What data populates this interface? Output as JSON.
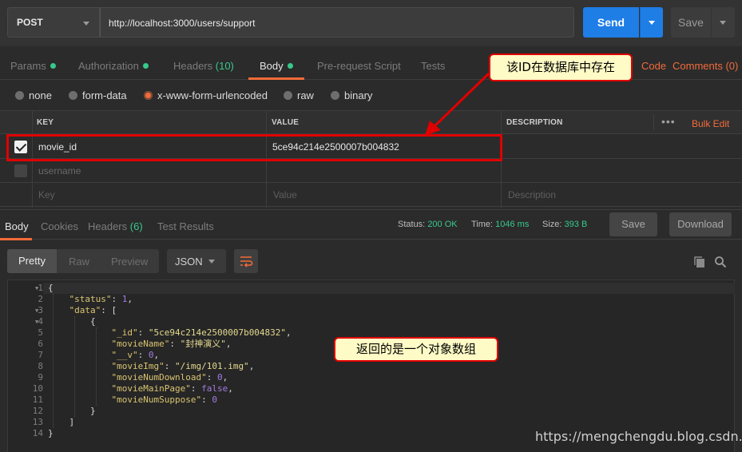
{
  "request": {
    "method": "POST",
    "url": "http://localhost:3000/users/support",
    "send_label": "Send",
    "save_label": "Save"
  },
  "request_tabs": [
    {
      "label": "Params",
      "dot": true,
      "active": false
    },
    {
      "label": "Authorization",
      "dot": true,
      "active": false
    },
    {
      "label": "Headers",
      "count": "(10)",
      "active": false
    },
    {
      "label": "Body",
      "dot": true,
      "active": true
    },
    {
      "label": "Pre-request Script",
      "active": false
    },
    {
      "label": "Tests",
      "active": false
    }
  ],
  "request_tabs_right": {
    "code": "Code",
    "comments": "Comments (0)"
  },
  "body_types": [
    {
      "label": "none",
      "selected": false
    },
    {
      "label": "form-data",
      "selected": false
    },
    {
      "label": "x-www-form-urlencoded",
      "selected": true
    },
    {
      "label": "raw",
      "selected": false
    },
    {
      "label": "binary",
      "selected": false
    }
  ],
  "params_table": {
    "headers": {
      "key": "KEY",
      "value": "VALUE",
      "description": "DESCRIPTION"
    },
    "bulk_edit": "Bulk Edit",
    "rows": [
      {
        "checked": true,
        "key": "movie_id",
        "value": "5ce94c214e2500007b004832",
        "description": ""
      },
      {
        "checked": false,
        "key": "username",
        "value": "",
        "description": ""
      }
    ],
    "placeholders": {
      "key": "Key",
      "value": "Value",
      "description": "Description"
    }
  },
  "response": {
    "tabs": [
      {
        "label": "Body",
        "active": true
      },
      {
        "label": "Cookies",
        "active": false
      },
      {
        "label": "Headers",
        "count": "(6)",
        "active": false
      },
      {
        "label": "Test Results",
        "active": false
      }
    ],
    "status_label": "Status:",
    "status": "200 OK",
    "time_label": "Time:",
    "time": "1046 ms",
    "size_label": "Size:",
    "size": "393 B",
    "save_label": "Save",
    "download_label": "Download"
  },
  "viewer": {
    "modes": [
      "Pretty",
      "Raw",
      "Preview"
    ],
    "active_mode": "Pretty",
    "format": "JSON"
  },
  "code_lines": [
    "{",
    "    \"status\": 1,",
    "    \"data\": [",
    "        {",
    "            \"_id\": \"5ce94c214e2500007b004832\",",
    "            \"movieName\": \"封神演义\",",
    "            \"__v\": 0,",
    "            \"movieImg\": \"/img/101.img\",",
    "            \"movieNumDownload\": 0,",
    "            \"movieMainPage\": false,",
    "            \"movieNumSuppose\": 0",
    "        }",
    "    ]",
    "}"
  ],
  "annotations": {
    "callout_id": "该ID在数据库中存在",
    "callout_array": "返回的是一个对象数组",
    "watermark": "https://mengchengdu.blog.csdn.net"
  },
  "colors": {
    "accent": "#f26b3a",
    "send": "#1f7de6",
    "success": "#37c98c",
    "annotation_red": "#e00000",
    "callout_bg": "#fefbc6"
  }
}
